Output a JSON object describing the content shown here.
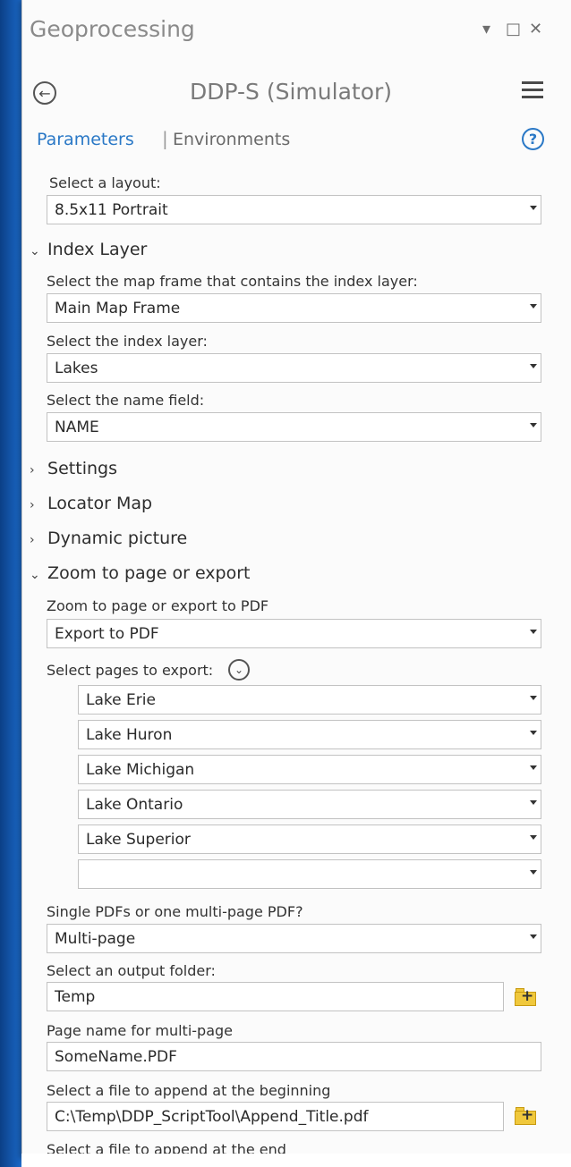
{
  "pane": {
    "title": "Geoprocessing",
    "controls": [
      "▾",
      "□",
      "✕"
    ]
  },
  "tool": {
    "title": "DDP-S (Simulator)"
  },
  "tabs": {
    "parameters": "Parameters",
    "separator": "|",
    "environments": "Environments"
  },
  "layout": {
    "label": "Select a layout:",
    "value": "8.5x11 Portrait"
  },
  "index_layer": {
    "heading": "Index Layer",
    "expanded": true,
    "map_frame_label": "Select the map frame that contains the index layer:",
    "map_frame_value": "Main Map Frame",
    "layer_label": "Select the index layer:",
    "layer_value": "Lakes",
    "name_field_label": "Select the name field:",
    "name_field_value": "NAME"
  },
  "collapsed_sections": [
    "Settings",
    "Locator Map",
    "Dynamic picture"
  ],
  "zoom_export": {
    "heading": "Zoom to page or export",
    "expanded": true,
    "mode_label": "Zoom to page or export to PDF",
    "mode_value": "Export to PDF",
    "pages_label": "Select pages to export:",
    "pages": [
      "Lake Erie",
      "Lake Huron",
      "Lake Michigan",
      "Lake Ontario",
      "Lake Superior",
      ""
    ],
    "pdf_mode_label": "Single PDFs or one multi-page PDF?",
    "pdf_mode_value": "Multi-page",
    "output_folder_label": "Select an output folder:",
    "output_folder_value": "Temp",
    "page_name_label": "Page name for multi-page",
    "page_name_value": "SomeName.PDF",
    "append_begin_label": "Select a file to append at the beginning",
    "append_begin_value": "C:\\Temp\\DDP_ScriptTool\\Append_Title.pdf",
    "append_end_label": "Select a file to append at the end"
  },
  "icons": {
    "back": "back-arrow-icon",
    "menu": "hamburger-menu-icon",
    "help": "help-icon",
    "expanded": "chevron-down-icon",
    "collapsed": "chevron-right-icon",
    "folder": "add-folder-icon"
  },
  "colors": {
    "accent": "#2a78c6",
    "folder": "#f0c83c"
  }
}
